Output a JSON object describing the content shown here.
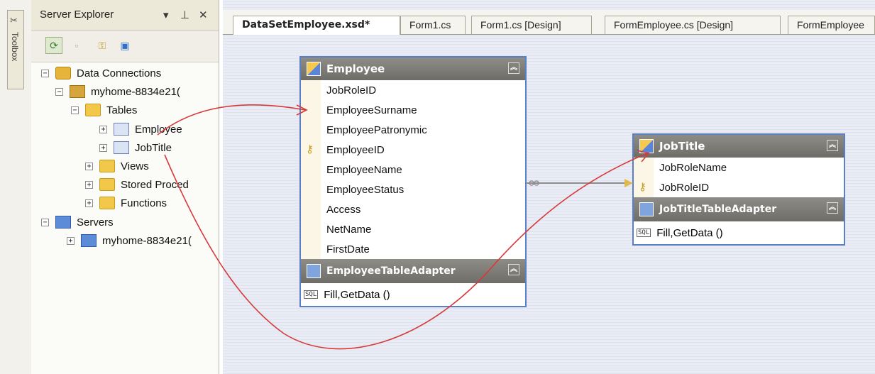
{
  "toolbox": {
    "label": "Toolbox",
    "icon": "toolbox-icon"
  },
  "server_explorer": {
    "title": "Server Explorer",
    "controls": {
      "dropdown": "▾",
      "pin": "⊥",
      "close": "✕"
    },
    "tree": {
      "data_connections": "Data Connections",
      "connection": "myhome-8834e21(",
      "tables": "Tables",
      "table_employee": "Employee",
      "table_jobtitle": "JobTitle",
      "views": "Views",
      "stored_procedures": "Stored Proced",
      "functions": "Functions",
      "servers": "Servers",
      "server_node": "myhome-8834e21("
    }
  },
  "tabs": [
    {
      "label": "DataSetEmployee.xsd*",
      "active": true
    },
    {
      "label": "Form1.cs",
      "active": false
    },
    {
      "label": "Form1.cs [Design]",
      "active": false
    },
    {
      "label": "FormEmployee.cs [Design]",
      "active": false
    },
    {
      "label": "FormEmployee",
      "active": false
    }
  ],
  "employee_table": {
    "title": "Employee",
    "columns": [
      "JobRoleID",
      "EmployeeSurname",
      "EmployeePatronymic",
      "EmployeeID",
      "EmployeeName",
      "EmployeeStatus",
      "Access",
      "NetName",
      "FirstDate"
    ],
    "key_column": "EmployeeID",
    "adapter_title": "EmployeeTableAdapter",
    "adapter_method": "Fill,GetData ()"
  },
  "jobtitle_table": {
    "title": "JobTitle",
    "columns": [
      "JobRoleName",
      "JobRoleID"
    ],
    "key_column": "JobRoleID",
    "adapter_title": "JobTitleTableAdapter",
    "adapter_method": "Fill,GetData ()"
  },
  "colors": {
    "table_border": "#5a7ec7",
    "header_gray": "#7a7872",
    "annotation_arrow": "#d63a3a",
    "relation_line": "#8d8d8d"
  }
}
